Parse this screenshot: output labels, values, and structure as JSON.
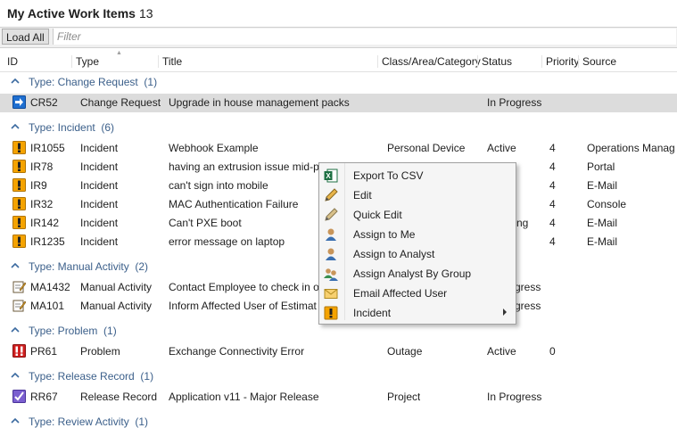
{
  "header": {
    "title": "My Active Work Items",
    "count": "13"
  },
  "toolbar": {
    "load_all": "Load All",
    "filter_placeholder": "Filter"
  },
  "columns": [
    "ID",
    "Type",
    "Title",
    "Class/Area/Category",
    "Status",
    "Priority",
    "Source"
  ],
  "groups": [
    {
      "label": "Type: Change Request",
      "count": "(1)"
    },
    {
      "label": "Type: Incident",
      "count": "(6)"
    },
    {
      "label": "Type: Manual Activity",
      "count": "(2)"
    },
    {
      "label": "Type: Problem",
      "count": "(1)"
    },
    {
      "label": "Type: Release Record",
      "count": "(1)"
    },
    {
      "label": "Type: Review Activity",
      "count": "(1)"
    }
  ],
  "rows": [
    {
      "id": "CR52",
      "type": "Change Request",
      "title": "Upgrade in house management packs",
      "cat": "",
      "status": "In Progress",
      "priority": "",
      "source": ""
    },
    {
      "id": "IR1055",
      "type": "Incident",
      "title": "Webhook Example",
      "cat": "Personal Device",
      "status": "Active",
      "priority": "4",
      "source": "Operations Manag"
    },
    {
      "id": "IR78",
      "type": "Incident",
      "title": "having an extrusion issue mid-p",
      "cat": "",
      "status": "",
      "priority": "4",
      "source": "Portal"
    },
    {
      "id": "IR9",
      "type": "Incident",
      "title": "can't sign into mobile",
      "cat": "",
      "status": "",
      "priority": "4",
      "source": "E-Mail"
    },
    {
      "id": "IR32",
      "type": "Incident",
      "title": "MAC Authentication Failure",
      "cat": "",
      "status": "",
      "priority": "4",
      "source": "Console"
    },
    {
      "id": "IR142",
      "type": "Incident",
      "title": "Can't PXE boot",
      "cat": "",
      "status": "ng",
      "priority": "4",
      "source": "E-Mail"
    },
    {
      "id": "IR1235",
      "type": "Incident",
      "title": "error message on laptop",
      "cat": "",
      "status": "",
      "priority": "4",
      "source": "E-Mail"
    },
    {
      "id": "MA1432",
      "type": "Manual Activity",
      "title": "Contact Employee to check in o",
      "cat": "",
      "status": "gress",
      "priority": "",
      "source": ""
    },
    {
      "id": "MA101",
      "type": "Manual Activity",
      "title": "Inform Affected User of Estimat",
      "cat": "",
      "status": "gress",
      "priority": "",
      "source": ""
    },
    {
      "id": "PR61",
      "type": "Problem",
      "title": "Exchange Connectivity Error",
      "cat": "Outage",
      "status": "Active",
      "priority": "0",
      "source": ""
    },
    {
      "id": "RR67",
      "type": "Release Record",
      "title": "Application v11 - Major Release",
      "cat": "Project",
      "status": "In Progress",
      "priority": "",
      "source": ""
    }
  ],
  "menu": [
    {
      "label": "Export To CSV",
      "icon": "excel-icon"
    },
    {
      "label": "Edit",
      "icon": "pencil-icon"
    },
    {
      "label": "Quick Edit",
      "icon": "pencil-icon"
    },
    {
      "label": "Assign to Me",
      "icon": "user-icon"
    },
    {
      "label": "Assign to Analyst",
      "icon": "user-icon"
    },
    {
      "label": "Assign Analyst By Group",
      "icon": "group-icon"
    },
    {
      "label": "Email Affected User",
      "icon": "envelope-icon"
    },
    {
      "label": "Incident",
      "icon": "incident-icon"
    }
  ],
  "colors": {
    "group_label": "#3b5f8a",
    "selected_row": "#dcdcdc",
    "incident_icon": "#f5a300",
    "problem_icon": "#d02020",
    "change_icon": "#1f6fd0"
  }
}
